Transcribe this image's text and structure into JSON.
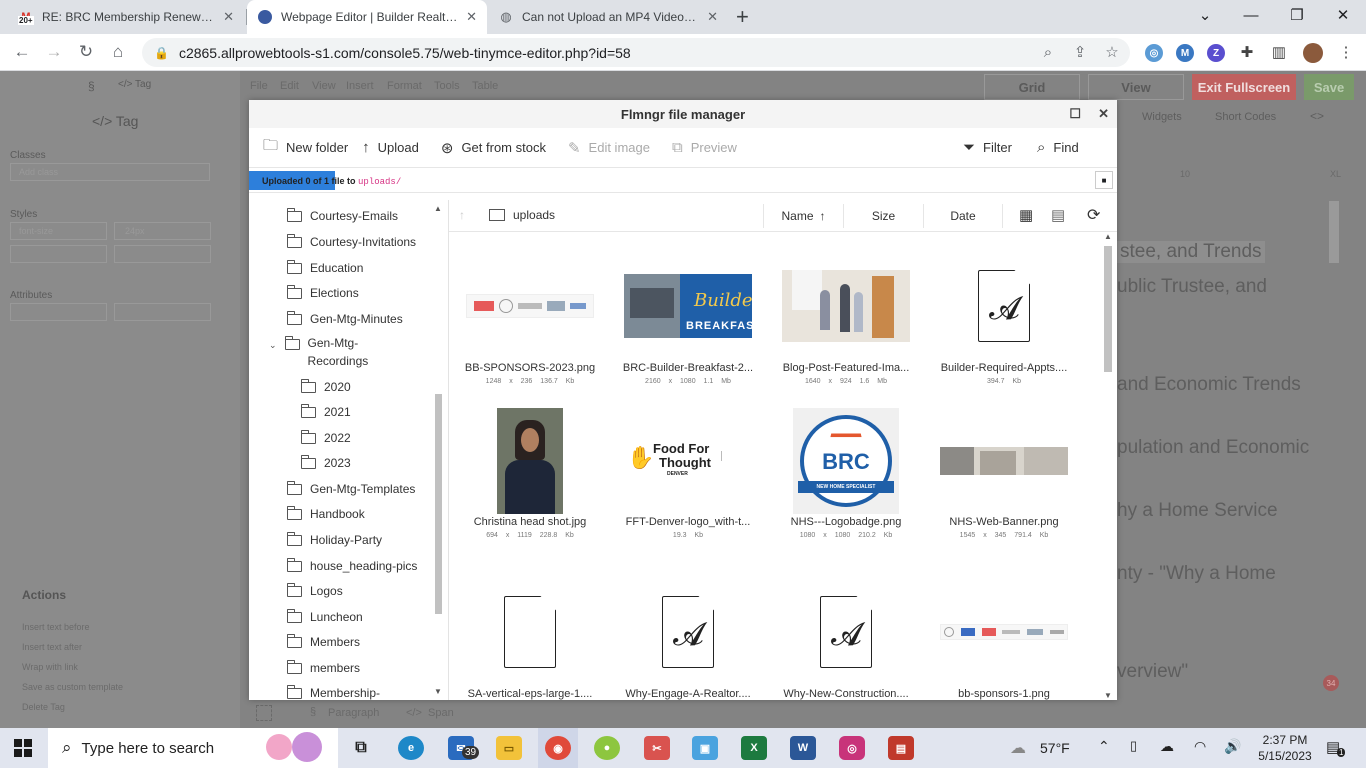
{
  "browser": {
    "tabs": [
      {
        "label": "RE: BRC Membership Renewal - r",
        "favicon": "gmail-icon",
        "badge": "20+"
      },
      {
        "label": "Webpage Editor | Builder Realty C",
        "favicon": "site-icon"
      },
      {
        "label": "Can not Upload an MP4 Video - a",
        "favicon": "globe-icon"
      }
    ],
    "new_tab": "+",
    "url": "c2865.allprowebtools-s1.com/console5.75/web-tinymce-editor.php?id=58"
  },
  "background": {
    "left_panel": {
      "section": "§",
      "tag_label": "</> Tag",
      "heading": "</>  Tag",
      "classes": "Classes",
      "classes_placeholder": "Add class",
      "styles": "Styles",
      "style_name": "font-size",
      "style_value": "24px",
      "attributes": "Attributes",
      "actions": "Actions",
      "action_items": [
        "Insert text before",
        "Insert text after",
        "Wrap with link",
        "Save as custom template",
        "Delete Tag"
      ]
    },
    "menu": [
      "File",
      "Edit",
      "View",
      "Insert",
      "Format",
      "Tools",
      "Table"
    ],
    "buttons": {
      "grid": "Grid",
      "view": "View",
      "exit_fullscreen": "Exit Fullscreen",
      "save": "Save"
    },
    "toolbar_items": [
      "Widgets",
      "Short Codes"
    ],
    "ruler": [
      "10",
      "XL"
    ],
    "text_lines": [
      "stee, and Trends",
      "ublic Trustee, and",
      "and Economic Trends",
      "pulation and Economic",
      "hy a Home Service",
      "nty - \"Why a Home",
      "verview\""
    ],
    "status": [
      "§",
      "Paragraph",
      "</>",
      "Span"
    ],
    "badge": "34"
  },
  "modal": {
    "title": "Flmngr file manager",
    "toolbar": {
      "new_folder": "New folder",
      "upload": "Upload",
      "get_from_stock": "Get from stock",
      "edit_image": "Edit image",
      "preview": "Preview",
      "filter": "Filter",
      "find": "Find"
    },
    "progress": {
      "prefix": "Uploaded 0 of 1",
      "middle": " file to ",
      "path": "uploads/"
    },
    "tree": {
      "folders": [
        "Courtesy-Emails",
        "Courtesy-Invitations",
        "Education",
        "Elections",
        "Gen-Mtg-Minutes"
      ],
      "expanded": "Gen-Mtg-Recordings",
      "subfolders": [
        "2020",
        "2021",
        "2022",
        "2023"
      ],
      "folders_after": [
        "Gen-Mtg-Templates",
        "Handbook",
        "Holiday-Party",
        "house_heading-pics",
        "Logos",
        "Luncheon",
        "Members",
        "members",
        "Membership-"
      ]
    },
    "list_header": {
      "folder": "uploads",
      "name": "Name",
      "size": "Size",
      "date": "Date"
    },
    "files": [
      {
        "name": "BB-SPONSORS-2023.png",
        "dims": "1248 x 236",
        "size": "136.7 Kb",
        "thumb": "sponsors-banner"
      },
      {
        "name": "BRC-Builder-Breakfast-2...",
        "dims": "2160 x 1080",
        "size": "1.1 Mb",
        "thumb": "builder-breakfast",
        "thumb_text": [
          "Builder",
          "BREAKFAST"
        ]
      },
      {
        "name": "Blog-Post-Featured-Ima...",
        "dims": "1640 x 924",
        "size": "1.6 Mb",
        "thumb": "photo-people"
      },
      {
        "name": "Builder-Required-Appts....",
        "dims": "",
        "size": "394.7 Kb",
        "thumb": "pdf"
      },
      {
        "name": "Christina head shot.jpg",
        "dims": "694 x 1119",
        "size": "228.8 Kb",
        "thumb": "portrait"
      },
      {
        "name": "FFT-Denver-logo_with-t...",
        "dims": "",
        "size": "19.3 Kb",
        "thumb": "food-for-thought",
        "thumb_text": [
          "Food For",
          "Thought",
          "DENVER"
        ]
      },
      {
        "name": "NHS---Logobadge.png",
        "dims": "1080 x 1080",
        "size": "210.2 Kb",
        "thumb": "brc-badge",
        "thumb_text": [
          "BRC",
          "NEW HOME SPECIALIST"
        ]
      },
      {
        "name": "NHS-Web-Banner.png",
        "dims": "1545 x 345",
        "size": "791.4 Kb",
        "thumb": "web-banner"
      },
      {
        "name": "SA-vertical-eps-large-1....",
        "dims": "",
        "size": "",
        "thumb": "file"
      },
      {
        "name": "Why-Engage-A-Realtor....",
        "dims": "",
        "size": "",
        "thumb": "pdf"
      },
      {
        "name": "Why-New-Construction....",
        "dims": "",
        "size": "",
        "thumb": "pdf"
      },
      {
        "name": "bb-sponsors-1.png",
        "dims": "",
        "size": "",
        "thumb": "sponsors-banner-2"
      }
    ]
  },
  "taskbar": {
    "search_placeholder": "Type here to search",
    "mail_badge": "39",
    "weather": "57°F",
    "time": "2:37 PM",
    "date": "5/15/2023",
    "notification_badge": "1"
  },
  "colors": {
    "upload_bar": "#2d7fdb",
    "exit_btn": "#c0605f",
    "save_btn": "#7a9a6a",
    "breakfast_bg": "#1f5fa8"
  }
}
